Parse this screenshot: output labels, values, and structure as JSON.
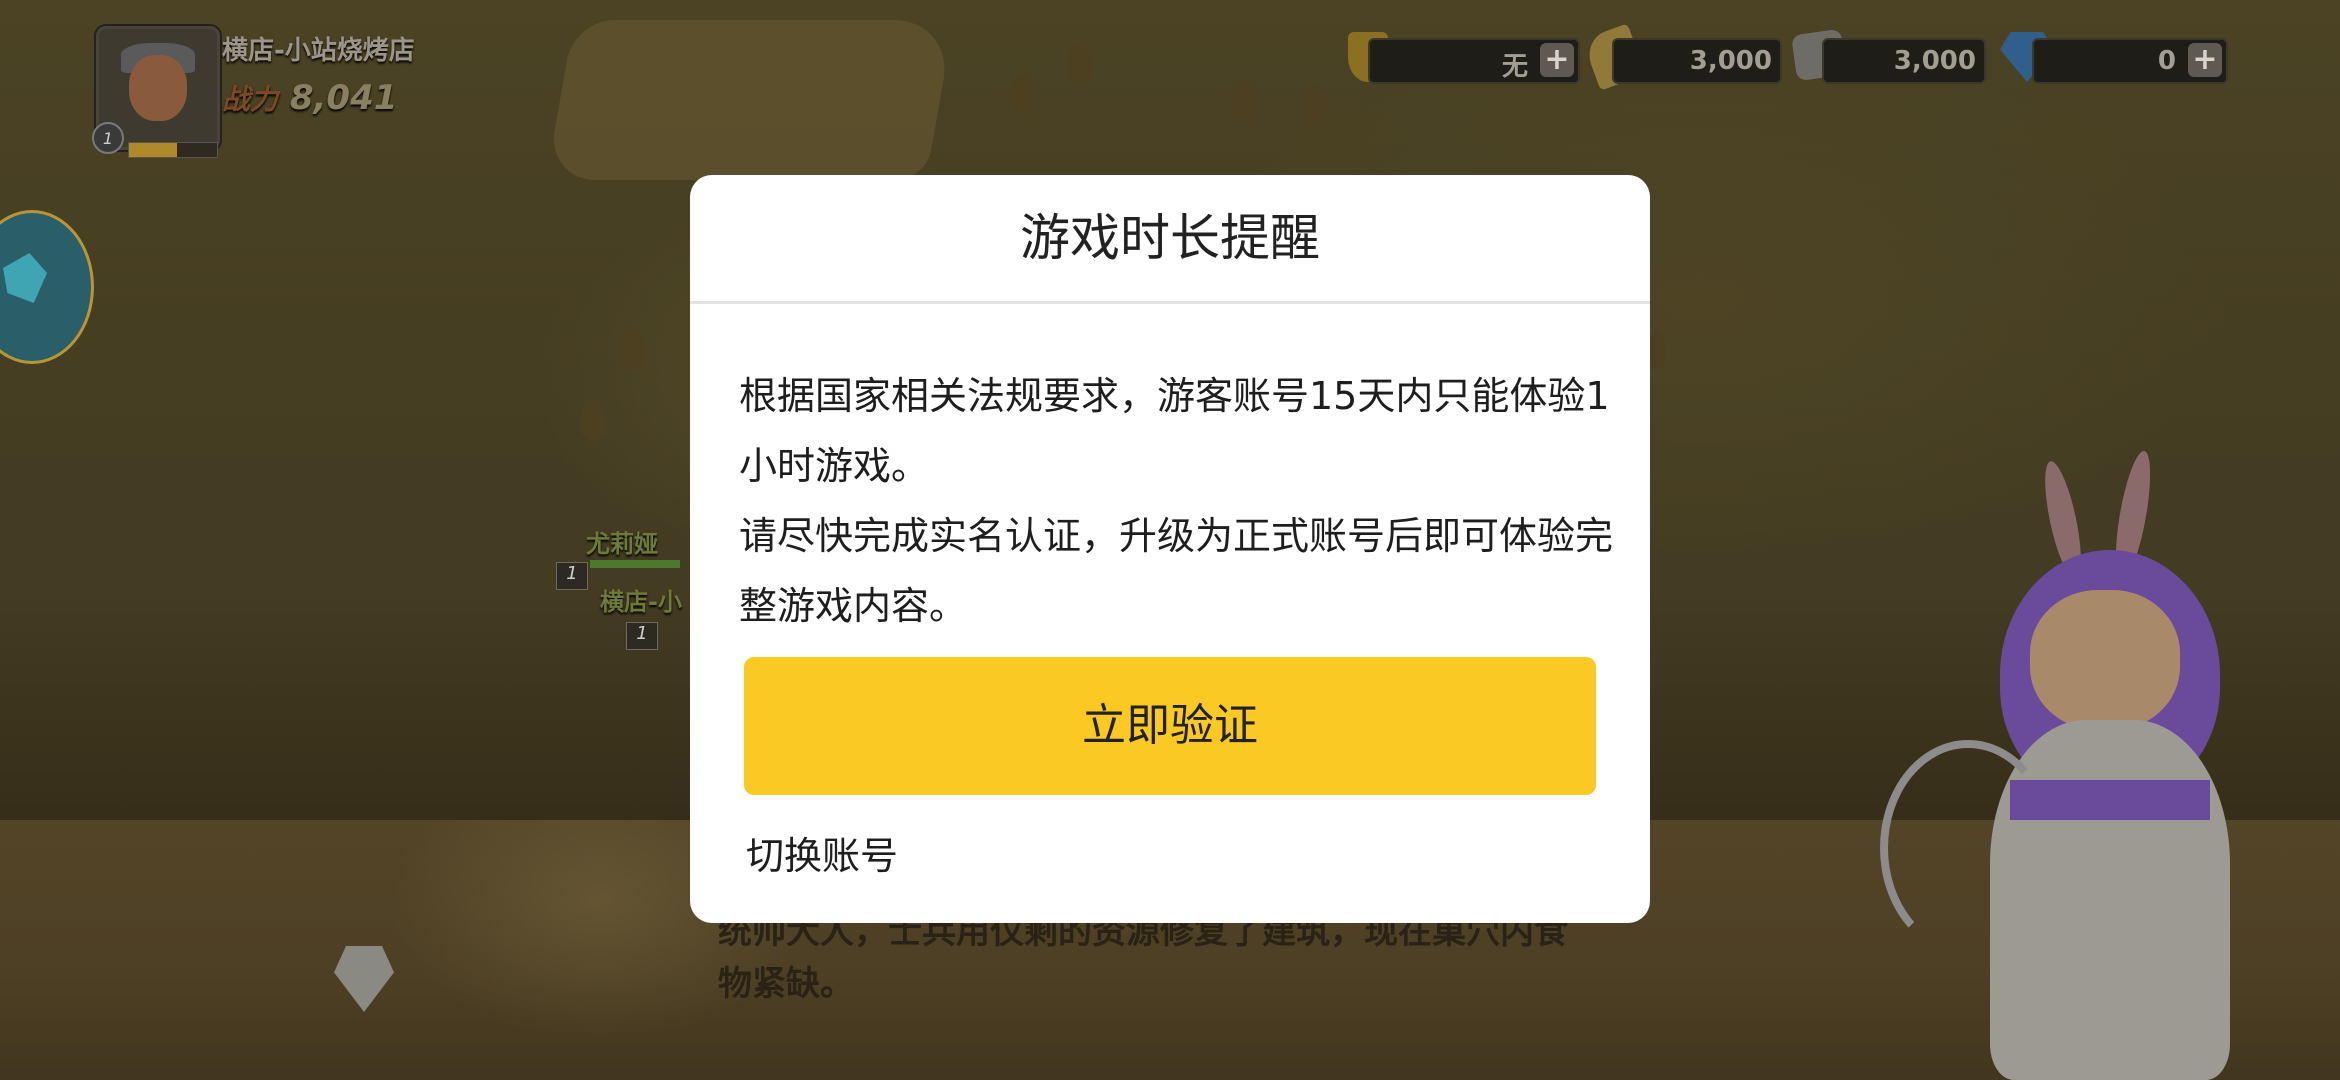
{
  "hud": {
    "player_name": "横店-小站烧烤店",
    "power_label": "战力",
    "power_value": "8,041",
    "level": "1",
    "xp_fraction": 0.55,
    "resources": [
      {
        "icon": "shield-icon",
        "value": "无"
      },
      {
        "icon": "wheat-icon",
        "value": "3,000"
      },
      {
        "icon": "stone-icon",
        "value": "3,000"
      },
      {
        "icon": "gem-icon",
        "value": "0"
      }
    ],
    "plus_symbol": "+"
  },
  "scene": {
    "npcs": [
      {
        "name": "尤莉娅",
        "level": "1"
      },
      {
        "name": "横店-小",
        "level": "1"
      }
    ],
    "story_text": "统帅大人，士兵用仅剩的资源修复了建筑，现在巢穴内食物紧缺。"
  },
  "modal": {
    "title": "游戏时长提醒",
    "paragraph_1": "根据国家相关法规要求，游客账号15天内只能体验1小时游戏。",
    "paragraph_2": "请尽快完成实名认证，升级为正式账号后即可体验完整游戏内容。",
    "verify_button": "立即验证",
    "switch_account": "切换账号"
  },
  "colors": {
    "accent": "#fbc924",
    "modal_bg": "#ffffff"
  }
}
